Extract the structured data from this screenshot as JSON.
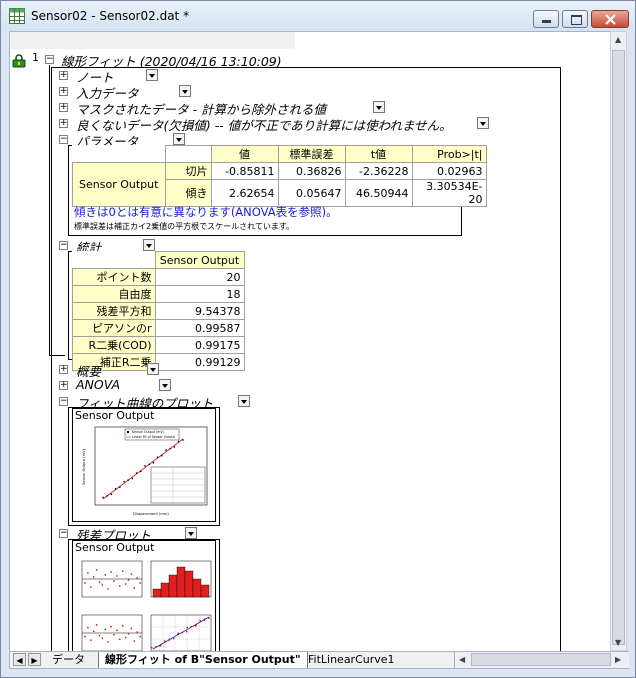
{
  "window": {
    "title": "Sensor02 - Sensor02.dat *"
  },
  "tree": {
    "node_number": "1",
    "root_label": "線形フィット (2020/04/16 13:10:09)",
    "sections": {
      "note": "ノート",
      "input": "入力データ",
      "masked": "マスクされたデータ - 計算から除外される値",
      "bad": "良くないデータ(欠損値) -- 値が不正であり計算には使われません。",
      "params": "パラメータ",
      "stats": "統計",
      "summary": "概要",
      "anova": "ANOVA",
      "fitplot": "フィット曲線のプロット",
      "residual": "残差プロット"
    }
  },
  "param_table": {
    "headers": [
      "値",
      "標準誤差",
      "t値",
      "Prob>|t|"
    ],
    "group": "Sensor Output",
    "rows": [
      {
        "name": "切片",
        "cells": [
          "-0.85811",
          "0.36826",
          "-2.36228",
          "0.02963"
        ]
      },
      {
        "name": "傾き",
        "cells": [
          "2.62654",
          "0.05647",
          "46.50944",
          "3.30534E-20"
        ]
      }
    ],
    "note1": "傾きは0とは有意に異なります(ANOVA表を参照)。",
    "note2": "標準誤差は補正カイ2乗値の平方根でスケールされています。"
  },
  "stats_table": {
    "header": "Sensor Output",
    "rows": [
      {
        "name": "ポイント数",
        "value": "20"
      },
      {
        "name": "自由度",
        "value": "18"
      },
      {
        "name": "残差平方和",
        "value": "9.54378"
      },
      {
        "name": "ピアソンのr",
        "value": "0.99587"
      },
      {
        "name": "R二乗(COD)",
        "value": "0.99175"
      },
      {
        "name": "補正R二乗",
        "value": "0.99129"
      }
    ]
  },
  "fit_plot": {
    "caption": "Sensor Output",
    "xlabel": "Displacement (mm)",
    "ylabel": "Sensor Output (mV)",
    "legend": [
      "Sensor Output (mV)",
      "Linear Fit of Sensor Output"
    ]
  },
  "residual_plot": {
    "caption": "Sensor Output"
  },
  "tabs": [
    {
      "label": "データ"
    },
    {
      "label": "線形フィット of B\"Sensor Output\""
    },
    {
      "label": "FitLinearCurve1"
    }
  ],
  "colors": {
    "accent": "#1a1ad8",
    "table_highlight": "#ffffc8",
    "bar_red": "#e02020",
    "fit_line": "#d02020"
  }
}
